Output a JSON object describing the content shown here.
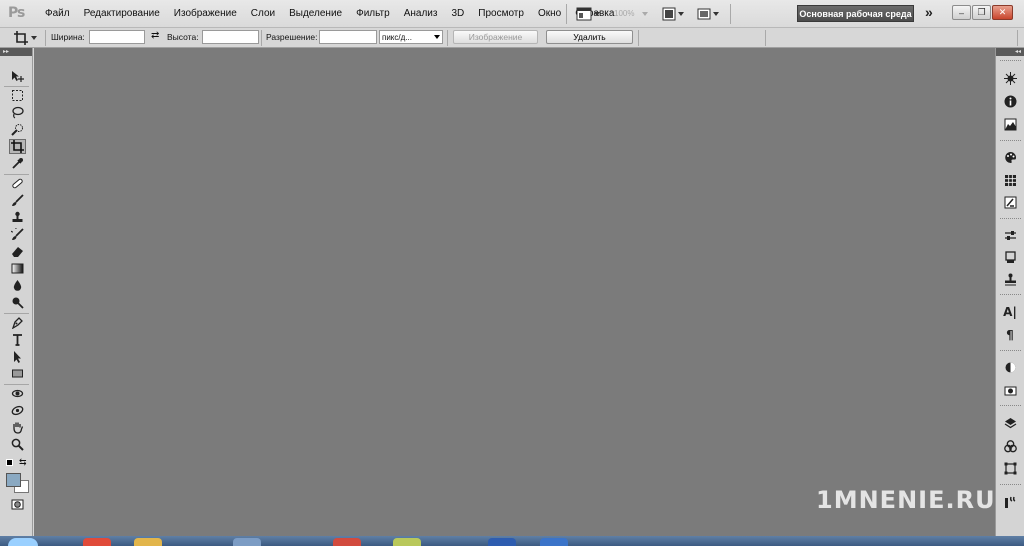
{
  "app": {
    "logo": "Ps"
  },
  "menu": [
    "Файл",
    "Редактирование",
    "Изображение",
    "Слои",
    "Выделение",
    "Фильтр",
    "Анализ",
    "3D",
    "Просмотр",
    "Окно",
    "Справка"
  ],
  "menubar": {
    "zoom": "100%",
    "workspace": "Основная рабочая среда",
    "more": "»"
  },
  "window_controls": {
    "minimize": "–",
    "restore": "❐",
    "close": "✕"
  },
  "options": {
    "width_label": "Ширина:",
    "width_value": "",
    "height_label": "Высота:",
    "height_value": "",
    "resolution_label": "Разрешение:",
    "resolution_value": "",
    "resolution_unit": "пикс/д...",
    "image_button": "Изображение",
    "delete_button": "Удалить"
  },
  "toolbar_left": [
    "move-tool",
    "marquee-tool",
    "lasso-tool",
    "quick-selection-tool",
    "crop-tool",
    "eyedropper-tool",
    "spot-healing-tool",
    "brush-tool",
    "clone-stamp-tool",
    "history-brush-tool",
    "eraser-tool",
    "gradient-tool",
    "blur-tool",
    "dodge-tool",
    "pen-tool",
    "type-tool",
    "path-selection-tool",
    "rectangle-tool",
    "3d-rotate-tool",
    "3d-orbit-tool",
    "hand-tool",
    "zoom-tool"
  ],
  "colors": {
    "foreground": "#8aa9c2",
    "background": "#ffffff",
    "canvas": "#7b7b7b",
    "workspace_btn": "#5a5a5a"
  },
  "dock_right": [
    "navigator",
    "info",
    "histogram",
    "color",
    "swatches",
    "styles",
    "adjustments",
    "masks",
    "clone-source",
    "character",
    "paragraph",
    "3d-panel",
    "layers",
    "channels",
    "paths",
    "actions"
  ],
  "dock_text": {
    "character": "A|",
    "paragraph": "¶"
  },
  "watermark": "1MNENIE.RU"
}
